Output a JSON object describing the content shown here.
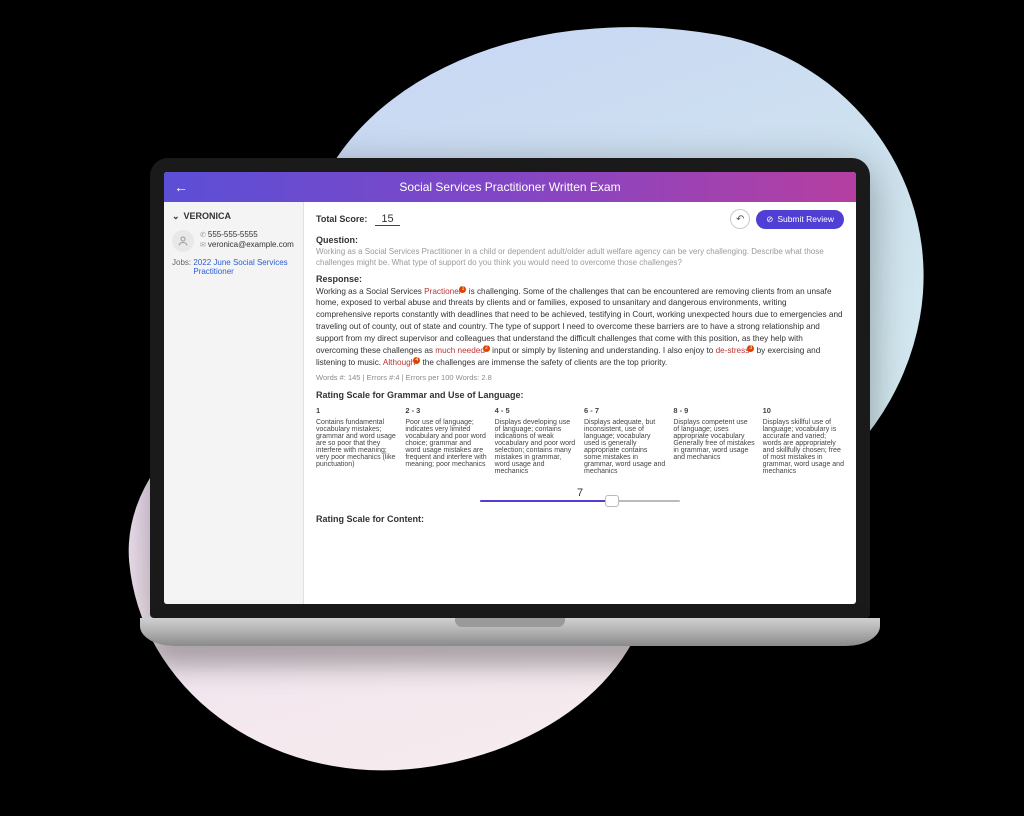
{
  "header": {
    "title": "Social Services Practitioner Written Exam"
  },
  "sidebar": {
    "name": "VERONICA",
    "phone": "555-555-5555",
    "email": "veronica@example.com",
    "jobs_label": "Jobs:",
    "job_link": "2022 June Social Services Practitioner"
  },
  "score": {
    "label": "Total Score:",
    "value": "15"
  },
  "actions": {
    "submit": "Submit Review"
  },
  "question": {
    "label": "Question:",
    "text": "Working as a Social Services Practitioner in a child or dependent adult/older adult welfare agency can be very challenging. Describe what those challenges might be. What type of support do you think you would need to overcome those challenges?"
  },
  "response": {
    "label": "Response:",
    "seg1": "Working as a Social Services ",
    "err1": "Practioner",
    "seg2": " is challenging. Some of the challenges that can be encountered are removing clients from an unsafe home, exposed to verbal abuse and threats by clients and or families, exposed to unsanitary and dangerous environments, writing comprehensive reports constantly with deadlines that need to be achieved, testifying in Court, working unexpected hours due to emergencies and traveling out of county, out of state and country. The type of support I need to overcome these barriers are to have a strong relationship and support from my direct supervisor and colleagues that understand the difficult challenges that come with this position, as they help with overcoming these challenges as ",
    "err2": "much needed",
    "seg3": " input or simply by listening and understanding. I also enjoy to ",
    "err3": "de-stress",
    "seg4": " by exercising and listening to music. ",
    "err4": "Although",
    "seg5": " the challenges are immense the safety of clients are the top priority."
  },
  "stats": "Words #: 145 | Errors #:4 | Errors per 100 Words: 2.8",
  "scale": {
    "title": "Rating Scale for Grammar and Use of Language:",
    "cols": [
      {
        "h": "1",
        "t": "Contains fundamental vocabulary mistakes; grammar and word usage are so poor that they interfere with meaning; very poor mechanics (like punctuation)"
      },
      {
        "h": "2 - 3",
        "t": "Poor use of language; indicates very limited vocabulary and poor word choice; grammar and word usage mistakes are frequent and interfere with meaning; poor mechanics"
      },
      {
        "h": "4 - 5",
        "t": "Displays developing use of language; contains indications of weak vocabulary and poor word selection; contains many mistakes in grammar, word usage and mechanics"
      },
      {
        "h": "6 - 7",
        "t": "Displays adequate, but inconsistent, use of language; vocabulary used is generally appropriate contains some mistakes in grammar, word usage and mechanics"
      },
      {
        "h": "8 - 9",
        "t": "Displays competent use of language; uses appropriate vocabulary Generally free of mistakes in grammar, word usage and mechanics"
      },
      {
        "h": "10",
        "t": "Displays skillful use of language; vocabulary is accurate and varied; words are appropriately and skillfully chosen; free of most mistakes in grammar, word usage and mechanics"
      }
    ]
  },
  "slider": {
    "value": "7"
  },
  "next_scale_title": "Rating Scale for Content:"
}
